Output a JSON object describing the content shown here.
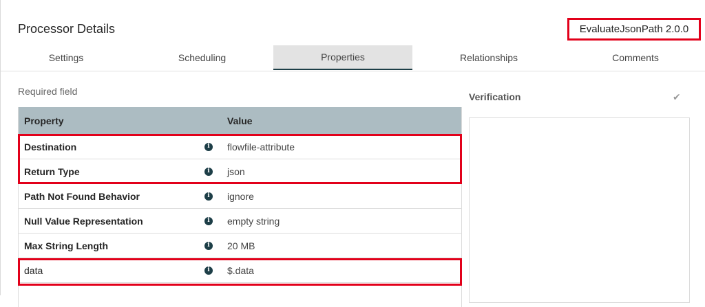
{
  "dialog": {
    "title": "Processor Details",
    "version": "EvaluateJsonPath 2.0.0"
  },
  "tabs": [
    {
      "label": "Settings"
    },
    {
      "label": "Scheduling"
    },
    {
      "label": "Properties",
      "active": true
    },
    {
      "label": "Relationships"
    },
    {
      "label": "Comments"
    }
  ],
  "properties": {
    "required_label": "Required field",
    "headers": {
      "property": "Property",
      "value": "Value"
    },
    "rows": [
      {
        "name": "Destination",
        "value": "flowfile-attribute",
        "info_icon": "info-icon"
      },
      {
        "name": "Return Type",
        "value": "json",
        "info_icon": "info-icon"
      },
      {
        "name": "Path Not Found Behavior",
        "value": "ignore",
        "info_icon": "info-icon"
      },
      {
        "name": "Null Value Representation",
        "value": "empty string",
        "info_icon": "info-icon"
      },
      {
        "name": "Max String Length",
        "value": "20 MB",
        "info_icon": "info-icon"
      },
      {
        "name": "data",
        "value": "$.data",
        "info_icon": "info-icon"
      }
    ]
  },
  "verification": {
    "title": "Verification",
    "icon": "check-icon"
  },
  "colors": {
    "highlight": "#e2001a",
    "header_bg": "#acbcc2",
    "accent": "#1d3e47"
  }
}
